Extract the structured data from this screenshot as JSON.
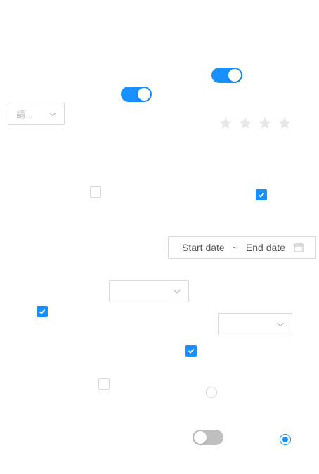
{
  "switches": {
    "top_right": {
      "state": "on"
    },
    "top_left": {
      "state": "on"
    },
    "bottom": {
      "state": "off"
    }
  },
  "select_top_left": {
    "value": "請...",
    "icon": "chevron-down-icon"
  },
  "select_middle": {
    "value": "",
    "icon": "chevron-down-icon"
  },
  "select_right": {
    "value": "",
    "icon": "chevron-down-icon"
  },
  "rate": {
    "value": 0,
    "count": 4,
    "icon": "star-icon"
  },
  "range_picker": {
    "start_placeholder": "Start date",
    "separator": "~",
    "end_placeholder": "End date",
    "icon": "calendar-icon"
  },
  "colors": {
    "accent": "#1890ff",
    "border": "#d9d9d9",
    "switch_off": "#bfbfbf",
    "star_empty": "#e8e8e8"
  }
}
